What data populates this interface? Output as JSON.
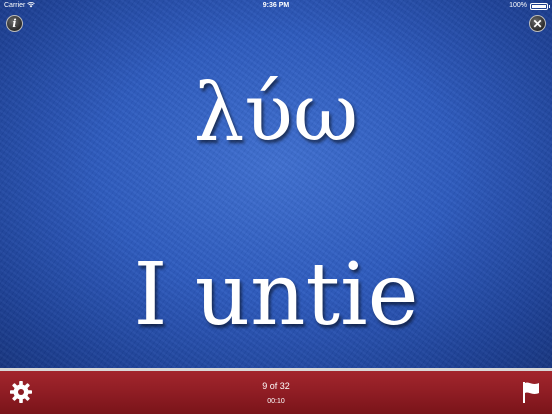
{
  "status_bar": {
    "carrier": "Carrier",
    "time": "9:36 PM",
    "battery": "100%"
  },
  "card": {
    "term": "λύω",
    "definition": "I untie",
    "background_color": "#2d5bbf"
  },
  "toolbar": {
    "info_icon": "i",
    "close_icon": "✕"
  },
  "footer": {
    "progress": "9 of 32",
    "timer": "00:10",
    "background_color": "#8b1b22",
    "settings_icon": "gear-icon",
    "flag_icon": "flag-icon"
  }
}
